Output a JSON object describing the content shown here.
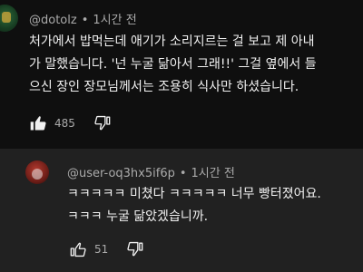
{
  "comment": {
    "handle": "@dotolz",
    "time": "1시간 전",
    "text_lines": [
      "처가에서 밥먹는데 애기가 소리지르는 걸 보고 제 아내",
      "가 말했습니다. '넌 누굴 닮아서 그래!!' 그걸 옆에서 들",
      "으신 장인 장모님께서는 조용히 식사만 하셨습니다."
    ],
    "likes": "485",
    "icons": {
      "like": "thumbs-up-icon-filled",
      "dislike": "thumbs-down-icon"
    }
  },
  "reply": {
    "handle": "@user-oq3hx5if6p",
    "time": "1시간 전",
    "text_lines": [
      "ㅋㅋㅋㅋㅋ 미쳤다 ㅋㅋㅋㅋㅋ 너무 빵터졌어요.",
      "ㅋㅋㅋ 누굴 닮았겠습니까."
    ],
    "likes": "51",
    "icons": {
      "like": "thumbs-up-icon",
      "dislike": "thumbs-down-icon"
    }
  },
  "colors": {
    "background": "#0f0f0f",
    "reply_background": "#212121",
    "text": "#f1f1f1",
    "secondary_text": "#aaaaaa"
  }
}
